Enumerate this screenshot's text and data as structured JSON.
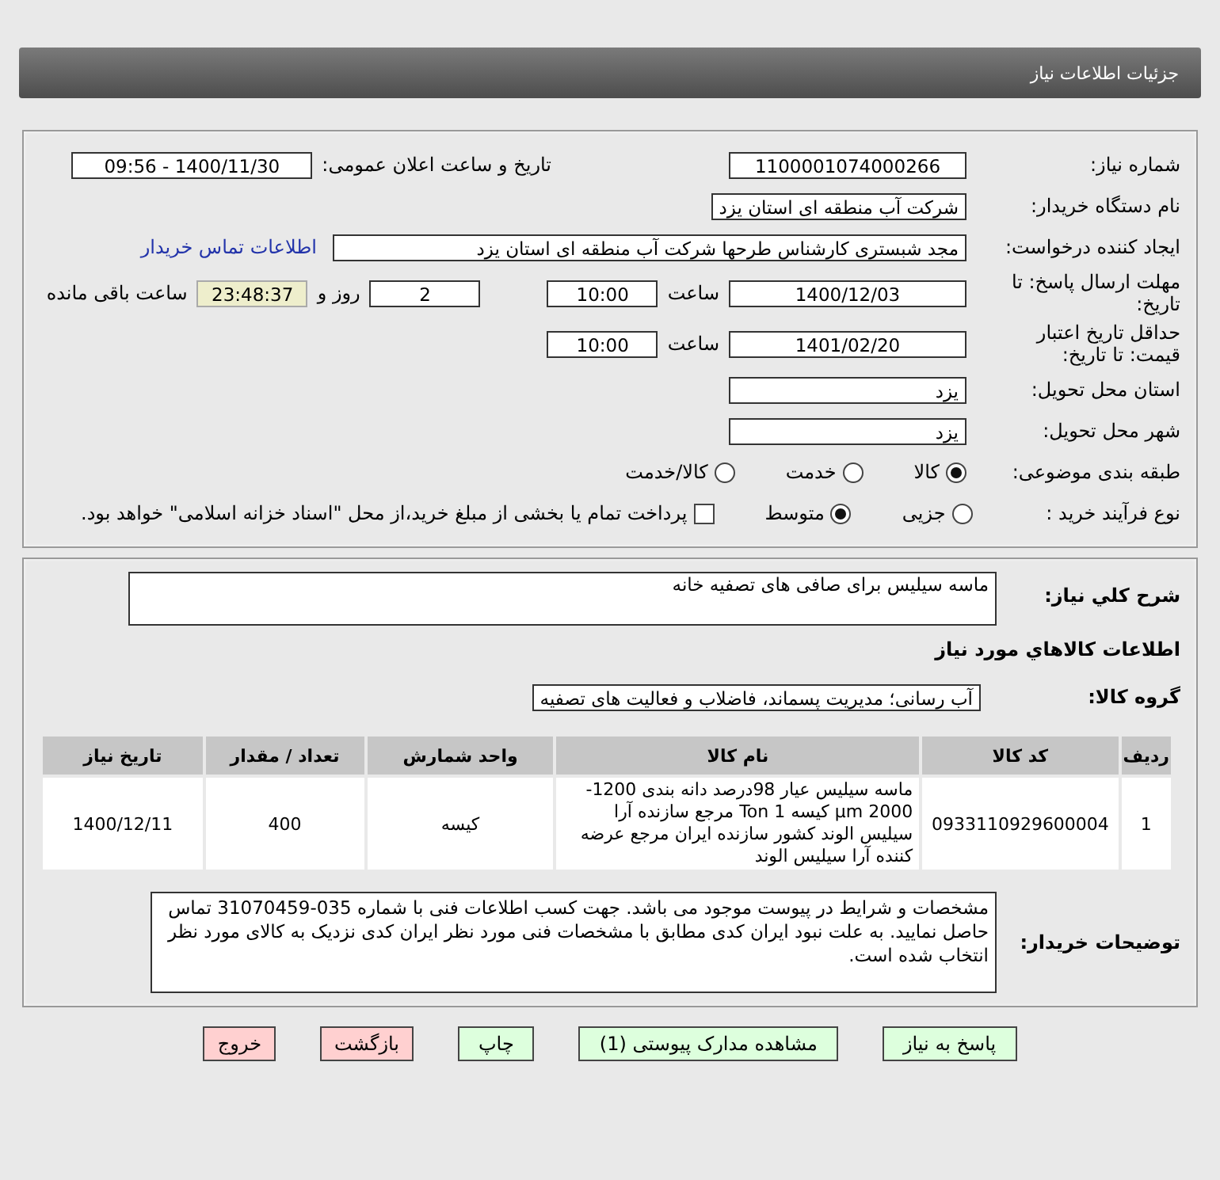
{
  "header": {
    "title": "جزئیات اطلاعات نیاز"
  },
  "need_number": {
    "label": "شماره نیاز:",
    "value": "1100001074000266"
  },
  "announce": {
    "label": "تاریخ و ساعت اعلان عمومی:",
    "value": "1400/11/30 - 09:56"
  },
  "buyer": {
    "label": "نام دستگاه خریدار:",
    "value": "شرکت آب منطقه ای استان یزد"
  },
  "requester": {
    "label": "ایجاد کننده درخواست:",
    "value": "مجد شبستری کارشناس طرحها شرکت آب منطقه ای استان یزد",
    "link": "اطلاعات تماس خریدار"
  },
  "deadline": {
    "label": "مهلت ارسال پاسخ: تا تاریخ:",
    "date": "1400/12/03",
    "time_label": "ساعت",
    "time": "10:00",
    "days": "2",
    "days_label": "روز و",
    "remaining": "23:48:37",
    "remaining_label": "ساعت باقی مانده"
  },
  "validity": {
    "label": "حداقل تاریخ اعتبار قیمت: تا تاریخ:",
    "date": "1401/02/20",
    "time_label": "ساعت",
    "time": "10:00"
  },
  "province": {
    "label": "استان محل تحویل:",
    "value": "یزد"
  },
  "city": {
    "label": "شهر محل تحویل:",
    "value": "یزد"
  },
  "category": {
    "label": "طبقه بندی موضوعی:",
    "options": [
      {
        "label": "کالا",
        "selected": true
      },
      {
        "label": "خدمت",
        "selected": false
      },
      {
        "label": "کالا/خدمت",
        "selected": false
      }
    ]
  },
  "process": {
    "label": "نوع فرآیند خرید :",
    "options": [
      {
        "label": "جزیی",
        "selected": false
      },
      {
        "label": "متوسط",
        "selected": true
      }
    ],
    "payment": {
      "label": "پرداخت تمام یا بخشی از مبلغ خرید،از محل \"اسناد خزانه اسلامی\" خواهد بود.",
      "checked": false
    }
  },
  "summary": {
    "label": "شرح کلي نياز:",
    "value": "ماسه سیلیس برای صافی های تصفیه خانه"
  },
  "goods_title": "اطلاعات کالاهاي مورد نياز",
  "group": {
    "label": "گروه کالا:",
    "value": "آب رسانی؛ مدیریت پسماند، فاضلاب و فعالیت های تصفیه"
  },
  "table": {
    "columns": [
      "ردیف",
      "کد کالا",
      "نام کالا",
      "واحد شمارش",
      "تعداد / مقدار",
      "تاریخ نیاز"
    ],
    "rows": [
      [
        "1",
        "0933110929600004",
        "ماسه سیلیس عیار 98درصد دانه بندی 1200-2000 μm کیسه 1 Ton مرجع سازنده آرا سیلیس الوند کشور سازنده ایران مرجع عرضه کننده آرا سیلیس الوند",
        "کیسه",
        "400",
        "1400/12/11"
      ]
    ]
  },
  "notes": {
    "label": "توضیحات خریدار:",
    "value": "مشخصات و شرایط در پیوست موجود می باشد. جهت کسب اطلاعات فنی با شماره 035-31070459 تماس حاصل نمایید. به علت نبود ایران کدی مطابق با مشخصات فنی مورد نظر ایران کدی نزدیک به کالای مورد نظر انتخاب شده است."
  },
  "buttons": [
    {
      "label": "پاسخ به نیاز",
      "kind": "primary"
    },
    {
      "label": "مشاهده مدارک پیوستی (1)",
      "kind": "primary"
    },
    {
      "label": "چاپ",
      "kind": "primary"
    },
    {
      "label": "بازگشت",
      "kind": "danger"
    },
    {
      "label": "خروج",
      "kind": "danger"
    }
  ]
}
